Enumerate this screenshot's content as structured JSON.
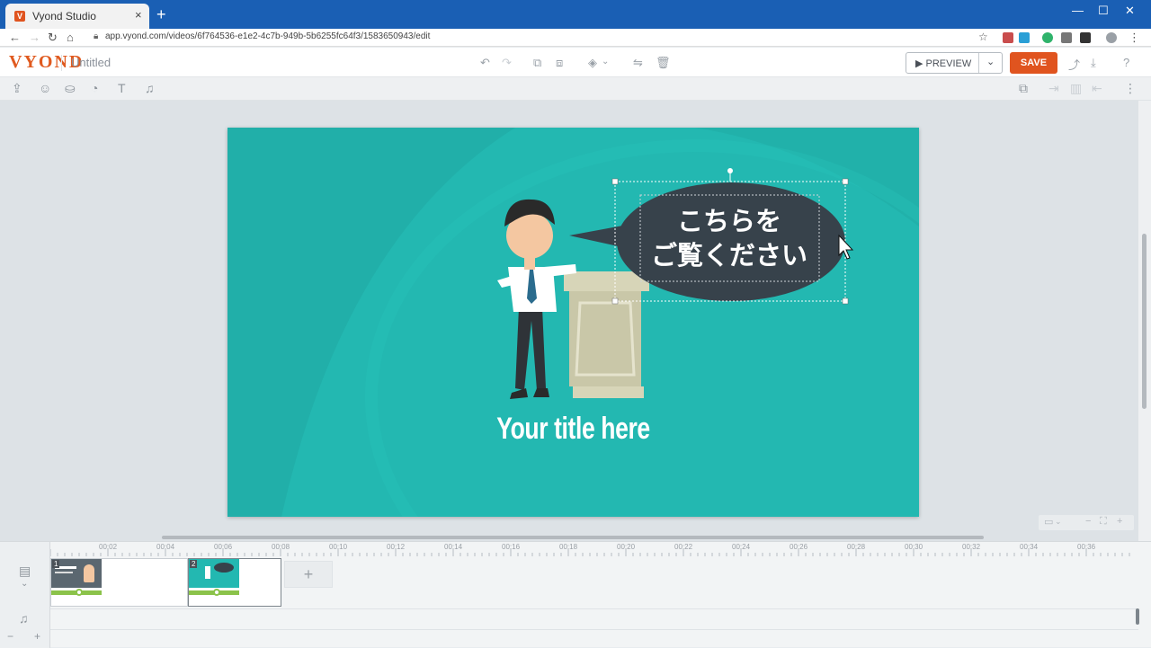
{
  "browser": {
    "tab_title": "Vyond Studio",
    "tab_close": "×",
    "new_tab": "+",
    "url": "app.vyond.com/videos/6f764536-e1e2-4c7b-949b-5b6255fc64f3/1583650943/edit",
    "window_controls": [
      "—",
      "☐",
      "✕"
    ]
  },
  "app": {
    "logo": "VYOND",
    "doc_title": "Untitled",
    "preview_label": "▶ PREVIEW",
    "preview_chevron": "⌄",
    "save_label": "SAVE"
  },
  "scene": {
    "bubble_line1": "こちらを",
    "bubble_line2": "ご覧ください",
    "title": "Your title here"
  },
  "timeline": {
    "ticks": [
      "00:02",
      "00:04",
      "00:06",
      "00:08",
      "00:10",
      "00:12",
      "00:14",
      "00:16",
      "00:18",
      "00:20",
      "00:22",
      "00:24",
      "00:26",
      "00:28",
      "00:30",
      "00:32",
      "00:34",
      "00:36"
    ],
    "scenes": [
      {
        "number": "1"
      },
      {
        "number": "2"
      }
    ],
    "add_label": "+"
  },
  "colors": {
    "brand": "#e0541f",
    "scene_bg": "#23b8b1",
    "bubble": "#37424b",
    "chrome": "#1a5fb4"
  }
}
